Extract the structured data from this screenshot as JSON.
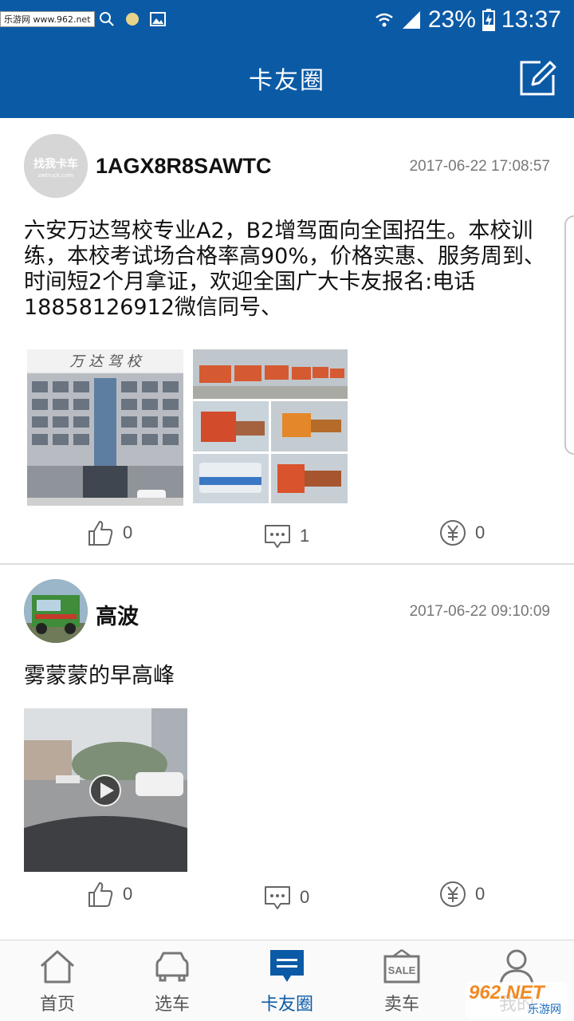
{
  "statusbar": {
    "watermark_site": "乐游网 www.962.net",
    "battery": "23%",
    "time": "13:37"
  },
  "header": {
    "title": "卡友圈"
  },
  "posts": [
    {
      "avatar_text": "找我卡车",
      "avatar_sub": "zwtruck.com",
      "username": "1AGX8R8SAWTC",
      "timestamp": "2017-06-22 17:08:57",
      "text": "六安万达驾校专业A2，B2增驾面向全国招生。本校训练，本校考试场合格率高90%，价格实惠、服务周到、时间短2个月拿证，欢迎全国广大卡友报名:电话18858126912微信同号、",
      "image1_sign": "万 达 驾 校",
      "likes": "0",
      "comments": "1",
      "tips": "0"
    },
    {
      "username": "高波",
      "timestamp": "2017-06-22 09:10:09",
      "text": "雾蒙蒙的早高峰",
      "likes": "0",
      "comments": "0",
      "tips": "0"
    }
  ],
  "tabbar": {
    "tabs": [
      {
        "label": "首页",
        "icon": "home-icon"
      },
      {
        "label": "选车",
        "icon": "car-icon"
      },
      {
        "label": "卡友圈",
        "icon": "chat-bubble-icon",
        "active": true
      },
      {
        "label": "卖车",
        "icon": "sale-tag-icon"
      },
      {
        "label": "我的",
        "icon": "user-icon"
      }
    ]
  },
  "watermark": {
    "logo": "962.NET",
    "sub": "乐游网"
  },
  "colors": {
    "brand": "#0b5aa6",
    "text": "#111111",
    "muted": "#777777"
  }
}
